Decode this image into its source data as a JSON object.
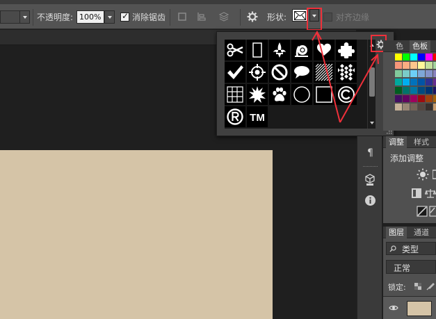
{
  "options": {
    "opacity_label": "不透明度:",
    "opacity_value": "100%",
    "antialias_label": "消除锯齿",
    "shape_label": "形状:",
    "align_edges_label": "对齐边缘"
  },
  "colors": {
    "canvas": "#d5c4a7",
    "highlight": "#f0303a",
    "popup_bg": "#404040"
  },
  "shapes": [
    "scissors",
    "blank-frame",
    "fleur-de-lis",
    "snail",
    "speech-bubble",
    "puzzle-piece",
    "checkmark",
    "crosshair",
    "no-sign",
    "talk-bubble",
    "hatched-square",
    "checkerboard",
    "grid",
    "starburst",
    "paw-print",
    "circle-frame",
    "square-frame",
    "copyright",
    "registered",
    "trademark"
  ],
  "trademark_text": "TM",
  "swatches_panel": {
    "tabs": [
      "色",
      "色板"
    ]
  },
  "adjustments_panel": {
    "tabs": [
      "调整",
      "样式"
    ],
    "title": "添加调整"
  },
  "layers_panel": {
    "tabs": [
      "图层",
      "通道"
    ],
    "filter_label": "类型",
    "blend_mode": "正常",
    "lock_label": "锁定:"
  }
}
